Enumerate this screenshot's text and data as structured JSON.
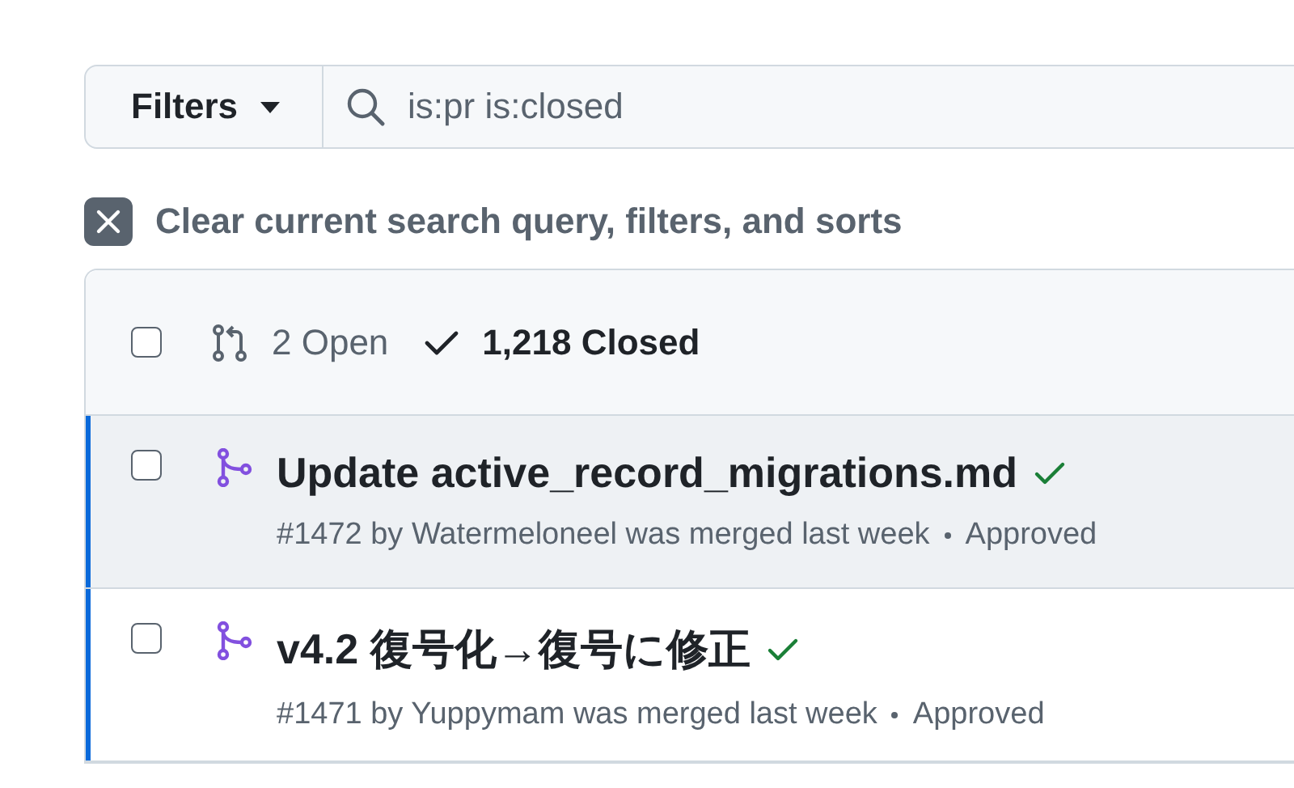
{
  "filter_bar": {
    "button": "Filters",
    "search": {
      "value": "is:pr is:closed"
    }
  },
  "clear_query": {
    "label": "Clear current search query, filters, and sorts"
  },
  "list_header": {
    "select_all": {
      "checked": false
    },
    "tabs": [
      {
        "kind": "open",
        "label": "2 Open",
        "selected": false
      },
      {
        "kind": "closed",
        "label": "1,218 Closed",
        "selected": true
      }
    ]
  },
  "pull_requests": [
    {
      "title": "Update active_record_migrations.md",
      "meta": "#1472 by Watermeloneel was merged last week",
      "review": "Approved",
      "checked": false,
      "unread": true,
      "hovered": true,
      "checks_passed": true
    },
    {
      "title": "v4.2 復号化→復号に修正",
      "meta": "#1471 by Yuppymam was merged last week",
      "review": "Approved",
      "checked": false,
      "unread": true,
      "hovered": false,
      "checks_passed": true
    }
  ]
}
